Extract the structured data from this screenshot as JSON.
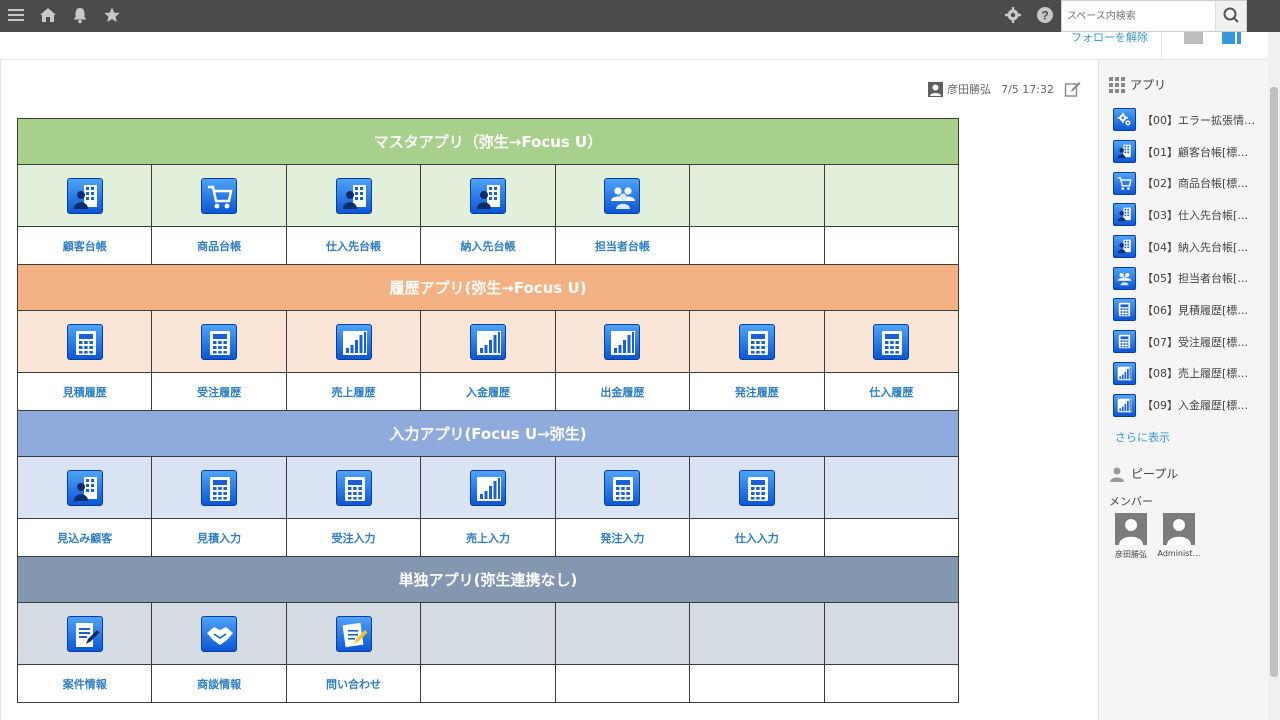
{
  "header": {
    "menu_icon": "hamburger-icon",
    "home_icon": "home-icon",
    "notify_icon": "bell-icon",
    "favorite_icon": "star-icon",
    "settings_icon": "gear-icon",
    "help_icon": "help-icon",
    "search": {
      "placeholder": "スペース内検索",
      "value": ""
    }
  },
  "subheader": {
    "unfollow_label": "フォローを解除"
  },
  "post": {
    "author": "彦田勝弘",
    "timestamp": "7/5 17:32"
  },
  "sections": [
    {
      "title": "マスタアプリ（弥生→Focus U）",
      "header_color": "#a8d08d",
      "icon_bg": "#e2efda",
      "apps": [
        {
          "label": "顧客台帳",
          "icon": "building-person-icon"
        },
        {
          "label": "商品台帳",
          "icon": "cart-icon"
        },
        {
          "label": "仕入先台帳",
          "icon": "building-person-icon"
        },
        {
          "label": "納入先台帳",
          "icon": "building-person-icon"
        },
        {
          "label": "担当者台帳",
          "icon": "group-icon"
        },
        {
          "label": "",
          "icon": ""
        },
        {
          "label": "",
          "icon": ""
        }
      ]
    },
    {
      "title": "履歴アプリ(弥生→Focus U)",
      "header_color": "#f4b183",
      "icon_bg": "#fbe5d6",
      "apps": [
        {
          "label": "見積履歴",
          "icon": "calculator-icon"
        },
        {
          "label": "受注履歴",
          "icon": "calculator-icon"
        },
        {
          "label": "売上履歴",
          "icon": "bar-chart-icon"
        },
        {
          "label": "入金履歴",
          "icon": "bar-chart-icon"
        },
        {
          "label": "出金履歴",
          "icon": "bar-chart-icon"
        },
        {
          "label": "発注履歴",
          "icon": "calculator-icon"
        },
        {
          "label": "仕入履歴",
          "icon": "calculator-icon"
        }
      ]
    },
    {
      "title": "入力アプリ(Focus U→弥生)",
      "header_color": "#8faadc",
      "icon_bg": "#dae3f3",
      "apps": [
        {
          "label": "見込み顧客",
          "icon": "building-person-icon"
        },
        {
          "label": "見積入力",
          "icon": "calculator-icon"
        },
        {
          "label": "受注入力",
          "icon": "calculator-icon"
        },
        {
          "label": "売上入力",
          "icon": "bar-chart-icon"
        },
        {
          "label": "発注入力",
          "icon": "calculator-icon"
        },
        {
          "label": "仕入入力",
          "icon": "calculator-icon"
        },
        {
          "label": "",
          "icon": ""
        }
      ]
    },
    {
      "title": "単独アプリ(弥生連携なし)",
      "header_color": "#8497b0",
      "icon_bg": "#d6dce4",
      "apps": [
        {
          "label": "案件情報",
          "icon": "clipboard-pen-icon"
        },
        {
          "label": "商談情報",
          "icon": "handshake-icon"
        },
        {
          "label": "問い合わせ",
          "icon": "document-pen-icon"
        },
        {
          "label": "",
          "icon": ""
        },
        {
          "label": "",
          "icon": ""
        },
        {
          "label": "",
          "icon": ""
        },
        {
          "label": "",
          "icon": ""
        }
      ]
    }
  ],
  "sidebar": {
    "apps_title": "アプリ",
    "apps": [
      {
        "label": "【00】エラー拡張情…",
        "icon": "gears-icon"
      },
      {
        "label": "【01】顧客台帳[標…",
        "icon": "building-person-icon"
      },
      {
        "label": "【02】商品台帳[標…",
        "icon": "cart-icon"
      },
      {
        "label": "【03】仕入先台帳[…",
        "icon": "building-person-icon"
      },
      {
        "label": "【04】納入先台帳[…",
        "icon": "building-person-icon"
      },
      {
        "label": "【05】担当者台帳[…",
        "icon": "group-icon"
      },
      {
        "label": "【06】見積履歴[標…",
        "icon": "calculator-icon"
      },
      {
        "label": "【07】受注履歴[標…",
        "icon": "calculator-icon"
      },
      {
        "label": "【08】売上履歴[標…",
        "icon": "bar-chart-icon"
      },
      {
        "label": "【09】入金履歴[標…",
        "icon": "bar-chart-icon"
      }
    ],
    "more_label": "さらに表示",
    "people_title": "ピープル",
    "members_label": "メンバー",
    "members": [
      {
        "name": "彦田勝弘"
      },
      {
        "name": "Administ…"
      }
    ]
  }
}
